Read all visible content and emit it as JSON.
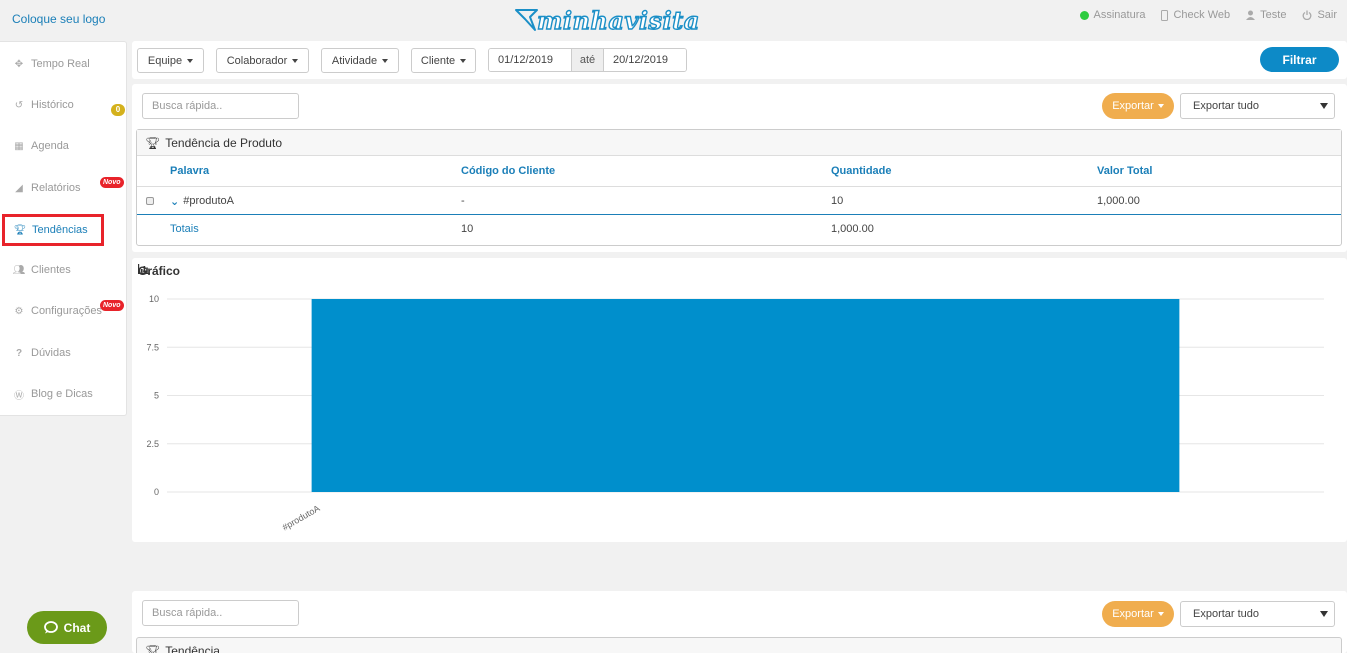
{
  "header": {
    "logo_placeholder": "Coloque seu logo",
    "brand": "minhavisita",
    "links": [
      {
        "label": "Assinatura",
        "icon": "status-dot-icon"
      },
      {
        "label": "Check Web",
        "icon": "mobile-icon"
      },
      {
        "label": "Teste",
        "icon": "user-icon"
      },
      {
        "label": "Sair",
        "icon": "power-icon"
      }
    ]
  },
  "sidebar": {
    "items": [
      {
        "label": "Tempo Real",
        "icon": "crosshair-icon"
      },
      {
        "label": "Histórico",
        "icon": "history-icon",
        "badge": "0"
      },
      {
        "label": "Agenda",
        "icon": "calendar-icon"
      },
      {
        "label": "Relatórios",
        "icon": "area-chart-icon",
        "badge_new": "Novo"
      },
      {
        "label": "Tendências",
        "icon": "trophy-icon",
        "active": true
      },
      {
        "label": "Clientes",
        "icon": "users-icon"
      },
      {
        "label": "Configurações",
        "icon": "gears-icon",
        "badge_new": "Novo"
      },
      {
        "label": "Dúvidas",
        "icon": "question-icon"
      },
      {
        "label": "Blog e Dicas",
        "icon": "wordpress-icon"
      }
    ]
  },
  "filters": {
    "dropdowns": [
      "Equipe",
      "Colaborador",
      "Atividade",
      "Cliente"
    ],
    "date_from": "01/12/2019",
    "date_sep": "até",
    "date_to": "20/12/2019",
    "submit": "Filtrar"
  },
  "trend_panel": {
    "search_placeholder": "Busca rápida..",
    "export_label": "Exportar",
    "export_all": "Exportar tudo",
    "table_title": "Tendência de Produto",
    "columns": [
      "Palavra",
      "Código do Cliente",
      "Quantidade",
      "Valor Total"
    ],
    "rows": [
      {
        "palavra": "#produtoA",
        "codigo": "-",
        "quantidade": "10",
        "valor": "1,000.00"
      }
    ],
    "totals": {
      "label": "Totais",
      "quantidade": "10",
      "valor": "1,000.00"
    }
  },
  "chart_panel": {
    "title": "Gráfico"
  },
  "chart_data": {
    "type": "bar",
    "categories": [
      "#produtoA"
    ],
    "values": [
      10
    ],
    "title": "",
    "xlabel": "",
    "ylabel": "",
    "ylim": [
      0,
      10
    ],
    "yticks": [
      "0",
      "2.5",
      "5",
      "7.5",
      "10"
    ],
    "grid": true,
    "bar_color": "#008fcc"
  },
  "trend_panel_2": {
    "search_placeholder": "Busca rápida..",
    "export_label": "Exportar",
    "export_all": "Exportar tudo",
    "table_title": "Tendência"
  },
  "chat": {
    "label": "Chat"
  },
  "colors": {
    "accent": "#1b7fb8",
    "primary_button": "#0d8ac7",
    "export_button": "#f0ad4e",
    "chat_button": "#6b9a19",
    "new_badge": "#e8232a"
  }
}
